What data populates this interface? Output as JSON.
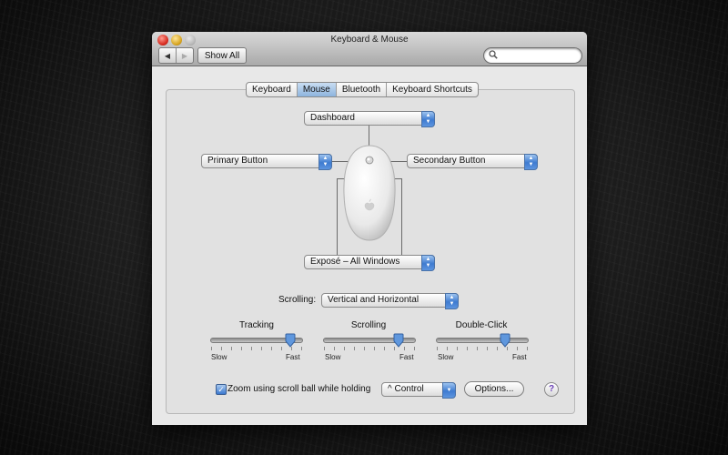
{
  "window": {
    "title": "Keyboard & Mouse"
  },
  "toolbar": {
    "back_glyph": "◀",
    "forward_glyph": "▶",
    "show_all_label": "Show All",
    "search_placeholder": "",
    "search_icon": "magnifier-icon"
  },
  "tabs": [
    {
      "label": "Keyboard",
      "selected": false
    },
    {
      "label": "Mouse",
      "selected": true
    },
    {
      "label": "Bluetooth",
      "selected": false
    },
    {
      "label": "Keyboard Shortcuts",
      "selected": false
    }
  ],
  "mouse_buttons": {
    "scroll_ball": "Dashboard",
    "primary": "Primary Button",
    "secondary": "Secondary Button",
    "side": "Exposé – All Windows"
  },
  "scrolling": {
    "label": "Scrolling:",
    "value": "Vertical and Horizontal"
  },
  "sliders": [
    {
      "title": "Tracking",
      "min_label": "Slow",
      "max_label": "Fast",
      "level": 0.88
    },
    {
      "title": "Scrolling",
      "min_label": "Slow",
      "max_label": "Fast",
      "level": 0.83
    },
    {
      "title": "Double-Click",
      "min_label": "Slow",
      "max_label": "Fast",
      "level": 0.76
    }
  ],
  "zoom": {
    "checked": true,
    "label": "Zoom using scroll ball while holding",
    "modifier": "^ Control"
  },
  "options_label": "Options...",
  "help_glyph": "?",
  "colors": {
    "accent_blue": "#3e7bd0",
    "window_bg": "#e8e8e8"
  }
}
